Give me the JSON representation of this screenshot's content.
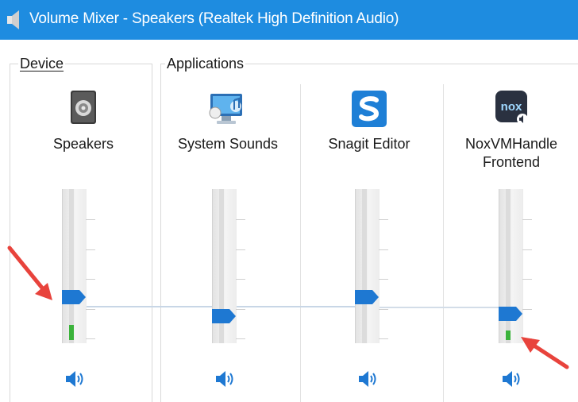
{
  "window": {
    "title": "Volume Mixer - Speakers (Realtek High Definition Audio)",
    "icon": "speaker-icon"
  },
  "sections": {
    "device_label": "Device",
    "applications_label": "Applications"
  },
  "device": {
    "name": "Speakers",
    "icon": "speakers-device-icon",
    "volume_fraction": 0.28,
    "peak_fraction": 0.1
  },
  "applications": [
    {
      "name": "System Sounds",
      "icon": "system-sounds-icon",
      "volume_fraction": 0.12,
      "peak_fraction": 0
    },
    {
      "name": "Snagit Editor",
      "icon": "snagit-icon",
      "volume_fraction": 0.28,
      "peak_fraction": 0
    },
    {
      "name": "NoxVMHandle Frontend",
      "icon": "nox-icon",
      "icon_text": "nox",
      "volume_fraction": 0.14,
      "peak_fraction": 0.06
    }
  ],
  "colors": {
    "titlebar": "#1e8ce0",
    "thumb": "#1e78d2",
    "meter": "#3bb33b",
    "annotation_arrow": "#e8433c"
  }
}
